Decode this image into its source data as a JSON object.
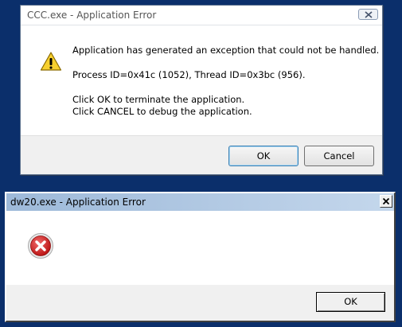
{
  "dialog1": {
    "title": "CCC.exe - Application Error",
    "icon": "warning-icon",
    "message": {
      "line1": "Application has generated an exception that could not be handled.",
      "line2": "Process ID=0x41c (1052), Thread ID=0x3bc (956).",
      "line3": "Click OK to terminate the application.",
      "line4": "Click CANCEL to debug the application."
    },
    "ok_label": "OK",
    "cancel_label": "Cancel"
  },
  "dialog2": {
    "title": "dw20.exe - Application Error",
    "icon": "error-icon",
    "ok_label": "OK"
  },
  "colors": {
    "desktop": "#0b2f6b",
    "warning_yellow": "#f7d02e",
    "error_red": "#d21f1f"
  }
}
